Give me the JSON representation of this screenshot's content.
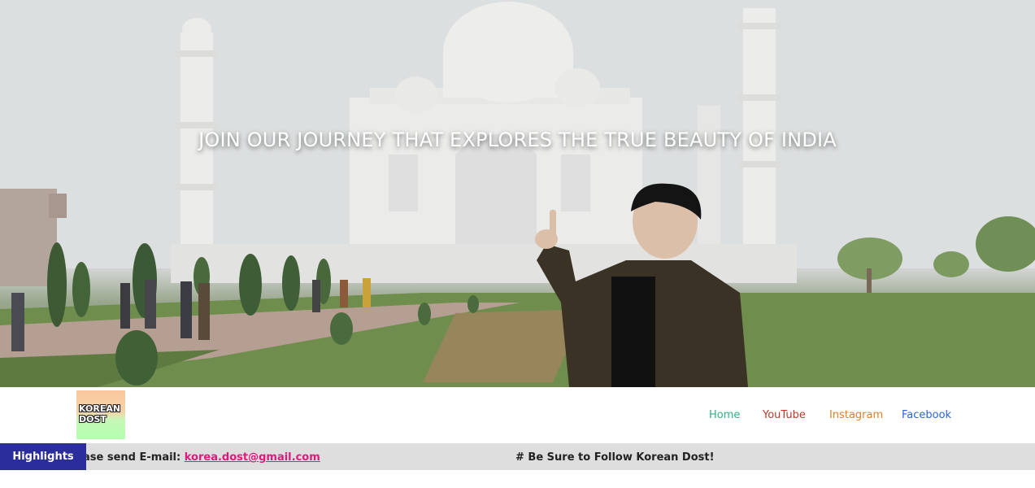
{
  "hero": {
    "title": "JOIN OUR JOURNEY THAT EXPLORES THE TRUE BEAUTY OF INDIA"
  },
  "logo": {
    "line1": "KOREAN",
    "line2": "DOST"
  },
  "nav": {
    "items": [
      {
        "label": "Home",
        "color": "#2fb27c"
      },
      {
        "label": "YouTube",
        "color": "#c0392b"
      },
      {
        "label": "Instagram",
        "color": "#e67e22"
      },
      {
        "label": "Facebook",
        "color": "#2c64d8"
      }
    ]
  },
  "ticker": {
    "label": "Highlights",
    "email_prefix": "ase send E-mail: ",
    "email": "korea.dost@gmail.com",
    "follow": "# Be Sure to Follow Korean Dost!"
  },
  "colors": {
    "ticker_label_bg": "#2b2d9c",
    "ticker_bg": "#dedede",
    "email_link": "#e0197d"
  }
}
